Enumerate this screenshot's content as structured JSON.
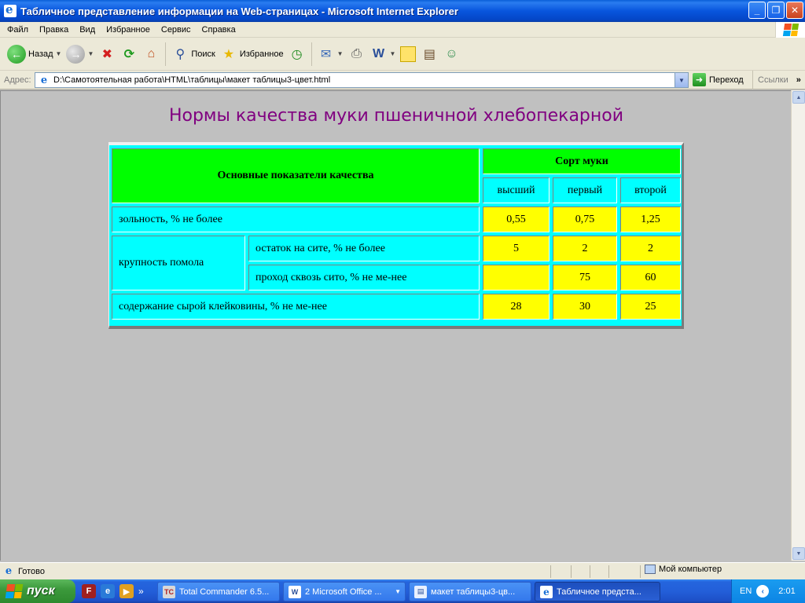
{
  "window": {
    "title": "Табличное представление информации на Web-страницах - Microsoft Internet Explorer"
  },
  "menu": [
    "Файл",
    "Правка",
    "Вид",
    "Избранное",
    "Сервис",
    "Справка"
  ],
  "toolbar": {
    "back": "Назад",
    "search": "Поиск",
    "favorites": "Избранное"
  },
  "address": {
    "label": "Адрес:",
    "value": "D:\\Самотоятельная работа\\HTML\\таблицы\\макет таблицы3-цвет.html",
    "go": "Переход",
    "links": "Ссылки"
  },
  "page": {
    "title": "Нормы качества муки пшеничной хлебопекарной",
    "table": {
      "header_indicators": "Основные показатели качества",
      "header_grade": "Сорт муки",
      "grades": [
        "высший",
        "первый",
        "второй"
      ],
      "rows": {
        "ash": {
          "label": "зольность, % не более",
          "values": [
            "0,55",
            "0,75",
            "1,25"
          ]
        },
        "grind": {
          "label": "крупность помола",
          "sub1": {
            "label": "остаток на сите, % не более",
            "values": [
              "5",
              "2",
              "2"
            ]
          },
          "sub2": {
            "label": "проход сквозь сито, % не ме-нее",
            "values": [
              "",
              "75",
              "60"
            ]
          }
        },
        "gluten": {
          "label": "содержание сырой клейковины, % не ме-нее",
          "values": [
            "28",
            "30",
            "25"
          ]
        }
      }
    }
  },
  "status": {
    "text": "Готово",
    "zone": "Мой компьютер"
  },
  "taskbar": {
    "start": "пуск",
    "tasks": [
      "Total Commander 6.5...",
      "2 Microsoft Office ...",
      "макет таблицы3-цв...",
      "Табличное предста..."
    ],
    "lang": "EN",
    "clock": "2:01"
  },
  "colors": {
    "header_bg": "#00ff00",
    "cell_bg": "#00ffff",
    "value_bg": "#ffff00",
    "title_color": "#800080",
    "page_bg": "#c0c0c0"
  }
}
